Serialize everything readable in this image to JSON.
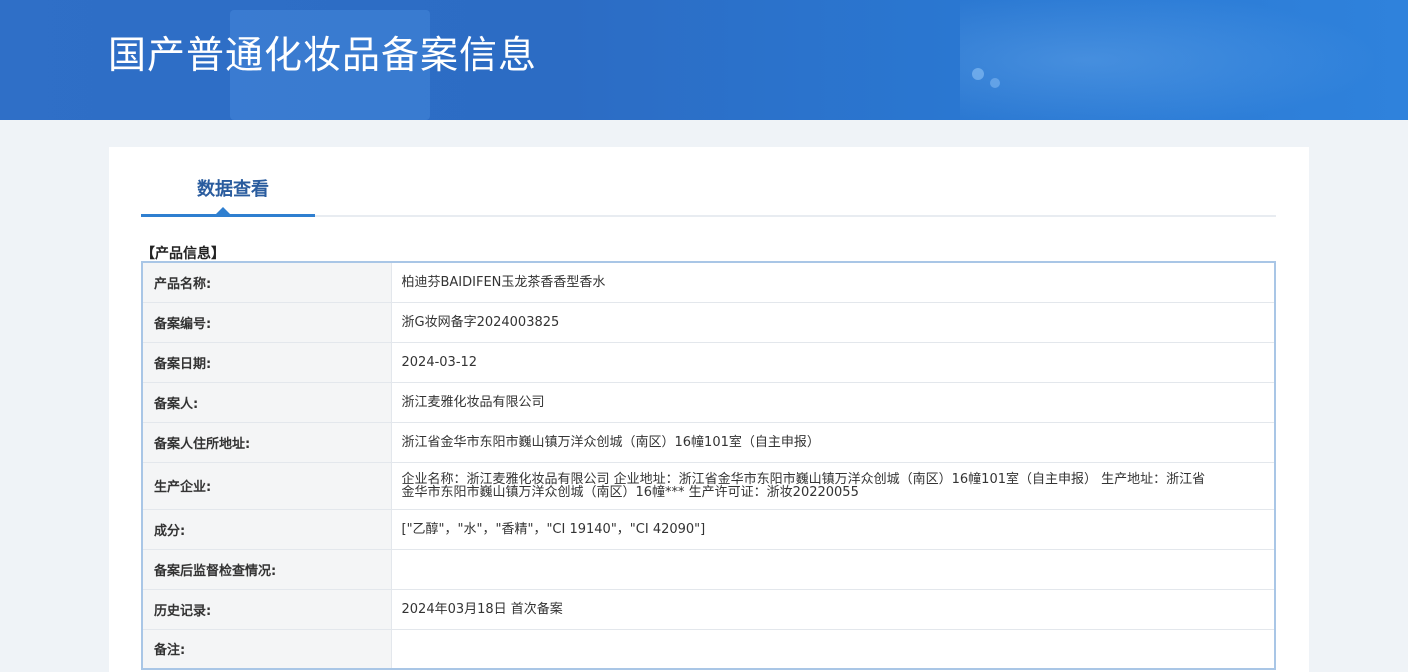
{
  "header": {
    "title": "国产普通化妆品备案信息"
  },
  "tabs": [
    {
      "label": "数据查看",
      "active": true
    }
  ],
  "section": {
    "title": "【产品信息】"
  },
  "rows": [
    {
      "label": "产品名称:",
      "value": "柏迪芬BAIDIFEN玉龙茶香香型香水"
    },
    {
      "label": "备案编号:",
      "value": "浙G妆网备字2024003825"
    },
    {
      "label": "备案日期:",
      "value": "2024-03-12"
    },
    {
      "label": "备案人:",
      "value": "浙江麦雅化妆品有限公司"
    },
    {
      "label": "备案人住所地址:",
      "value": "浙江省金华市东阳市巍山镇万洋众创城（南区）16幢101室（自主申报）"
    },
    {
      "label": "生产企业:",
      "value": "企业名称：浙江麦雅化妆品有限公司 企业地址：浙江省金华市东阳市巍山镇万洋众创城（南区）16幢101室（自主申报） 生产地址：浙江省金华市东阳市巍山镇万洋众创城（南区）16幢*** 生产许可证：浙妆20220055"
    },
    {
      "label": "成分:",
      "value": "[\"乙醇\"，\"水\"，\"香精\"，\"CI 19140\"，\"CI 42090\"]"
    },
    {
      "label": "备案后监督检查情况:",
      "value": ""
    },
    {
      "label": "历史记录:",
      "value": "2024年03月18日 首次备案"
    },
    {
      "label": "备注:",
      "value": ""
    }
  ],
  "colors": {
    "banner": "#2c6cc4",
    "accent": "#2f7fd0",
    "tab_text": "#2a5c9e",
    "page_bg": "#eff3f7",
    "table_border": "#a9c6e6",
    "label_bg": "#f4f5f6"
  }
}
